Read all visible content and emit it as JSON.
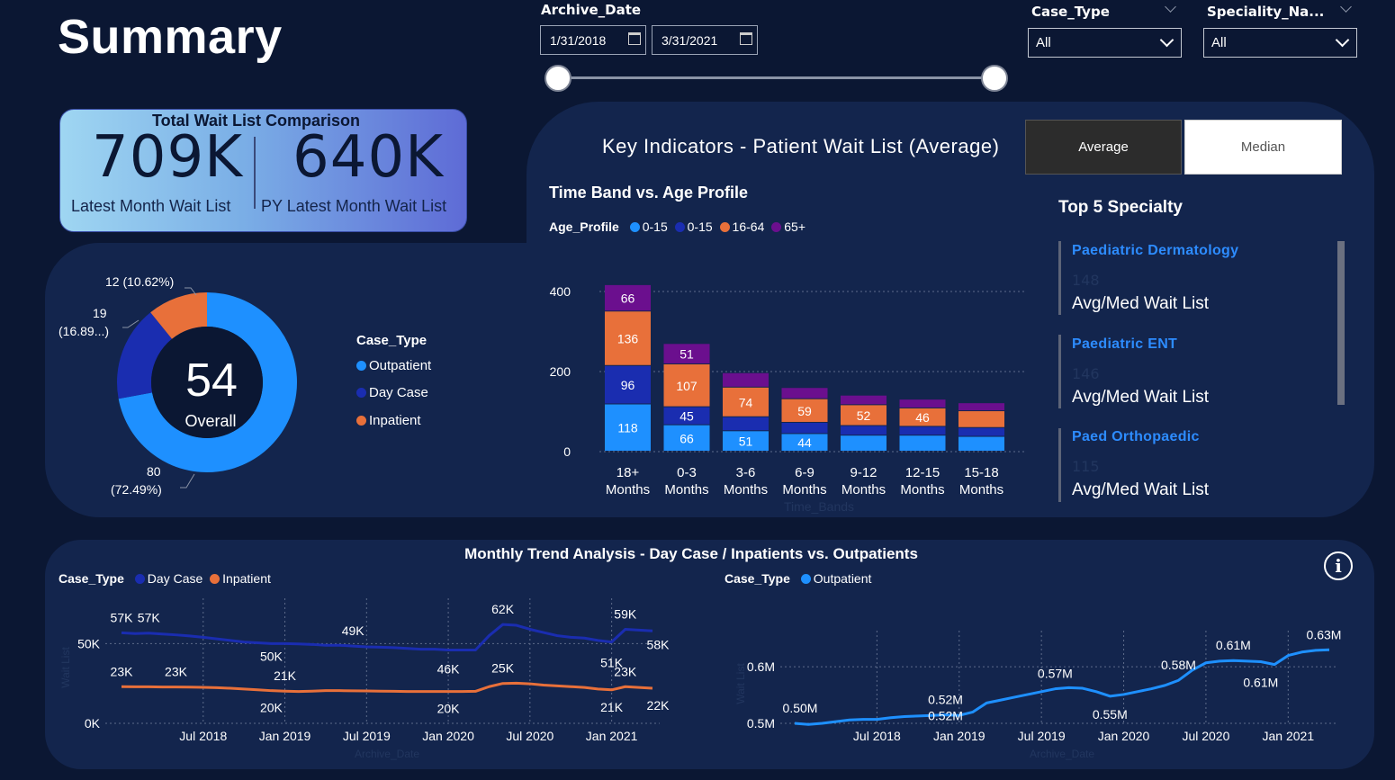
{
  "page_title": "Summary",
  "filters": {
    "archive_date_label": "Archive_Date",
    "date_start": "1/31/2018",
    "date_end": "3/31/2021",
    "case_type_label": "Case_Type",
    "case_type_value": "All",
    "speciality_label": "Speciality_Na...",
    "speciality_value": "All"
  },
  "kpi": {
    "title": "Total Wait List Comparison",
    "latest_value": "709K",
    "latest_label": "Latest Month Wait List",
    "py_value": "640K",
    "py_label": "PY Latest Month Wait List"
  },
  "donut": {
    "center_value": "54",
    "center_label": "Overall",
    "legend_title": "Case_Type",
    "slices": [
      {
        "name": "Outpatient",
        "value": 80,
        "label_value": "80",
        "label_pct": "(72.49%)",
        "color": "#1e90ff"
      },
      {
        "name": "Day Case",
        "value": 19,
        "label_value": "19",
        "label_pct": "(16.89...)",
        "color": "#1a2db0"
      },
      {
        "name": "Inpatient",
        "value": 12,
        "label_value": "12 (10.62%)",
        "label_pct": "",
        "color": "#e8703a"
      }
    ]
  },
  "key_indicators": {
    "title": "Key Indicators - Patient Wait List (Average)",
    "toggle_average": "Average",
    "toggle_median": "Median"
  },
  "bar_chart_title": "Time Band vs. Age Profile",
  "bar_legend": {
    "title": "Age_Profile",
    "items": [
      {
        "label": "0-15",
        "color": "#1e90ff"
      },
      {
        "label": "0-15",
        "color": "#1a2db0"
      },
      {
        "label": "16-64",
        "color": "#e8703a"
      },
      {
        "label": "65+",
        "color": "#6b0f8e"
      }
    ]
  },
  "bar_x_axis_title": "Time_Bands",
  "top5": {
    "title": "Top 5 Specialty",
    "items": [
      {
        "name": "Paediatric Dermatology",
        "value": "148",
        "label": "Avg/Med Wait List"
      },
      {
        "name": "Paediatric ENT",
        "value": "146",
        "label": "Avg/Med Wait List"
      },
      {
        "name": "Paed Orthopaedic",
        "value": "115",
        "label": "Avg/Med Wait List"
      }
    ]
  },
  "trend": {
    "title": "Monthly Trend Analysis - Day Case / Inpatients vs. Outpatients",
    "left_legend_title": "Case_Type",
    "left_legend": [
      {
        "label": "Day Case",
        "color": "#1a2db0"
      },
      {
        "label": "Inpatient",
        "color": "#e8703a"
      }
    ],
    "right_legend_title": "Case_Type",
    "right_legend": [
      {
        "label": "Outpatient",
        "color": "#1e90ff"
      }
    ],
    "left_y_title": "Wait List",
    "right_y_title": "Wait List",
    "left_x_title": "Archive_Date",
    "right_x_title": "Archive_Date",
    "info_icon": "info-icon"
  },
  "chart_data": [
    {
      "type": "pie",
      "categories": [
        "Outpatient",
        "Day Case",
        "Inpatient"
      ],
      "values": [
        80,
        19,
        12
      ]
    },
    {
      "type": "bar",
      "title": "Time Band vs. Age Profile",
      "categories": [
        "18+ Months",
        "0-3 Months",
        "3-6 Months",
        "6-9 Months",
        "9-12 Months",
        "12-15 Months",
        "15-18 Months"
      ],
      "ylim": [
        0,
        400
      ],
      "yticks": [
        0,
        200,
        400
      ],
      "series": [
        {
          "name": "0-15",
          "color": "#1e90ff",
          "values": [
            118,
            66,
            51,
            44,
            40,
            40,
            37
          ],
          "labels": [
            "118",
            "66",
            "51",
            "44",
            "",
            "",
            ""
          ]
        },
        {
          "name": "0-15",
          "color": "#1a2db0",
          "values": [
            96,
            45,
            35,
            28,
            24,
            22,
            22
          ],
          "labels": [
            "96",
            "45",
            "",
            "",
            "",
            "",
            ""
          ]
        },
        {
          "name": "16-64",
          "color": "#e8703a",
          "values": [
            136,
            107,
            74,
            59,
            52,
            46,
            42
          ],
          "labels": [
            "136",
            "107",
            "74",
            "59",
            "52",
            "46",
            ""
          ]
        },
        {
          "name": "65+",
          "color": "#6b0f8e",
          "values": [
            66,
            51,
            36,
            28,
            24,
            22,
            20
          ],
          "labels": [
            "66",
            "51",
            "",
            "",
            "",
            "",
            ""
          ]
        }
      ]
    },
    {
      "type": "line",
      "x_ticks": [
        "Jul 2018",
        "Jan 2019",
        "Jul 2019",
        "Jan 2020",
        "Jul 2020",
        "Jan 2021"
      ],
      "y_ticks": [
        "0K",
        "50K"
      ],
      "ylim": [
        0,
        70000
      ],
      "series": [
        {
          "name": "Day Case",
          "color": "#1a2db0",
          "values": [
            56800,
            56300,
            56600,
            56000,
            55500,
            54800,
            54000,
            53000,
            52000,
            51000,
            50500,
            50000,
            50000,
            49800,
            49500,
            49000,
            49000,
            48500,
            48000,
            47800,
            47500,
            47000,
            46500,
            46500,
            46000,
            46000,
            46000,
            55000,
            62000,
            61500,
            59000,
            57000,
            55000,
            54000,
            53500,
            52000,
            51000,
            59000,
            58500,
            58000
          ]
        },
        {
          "name": "Inpatient",
          "color": "#e8703a",
          "values": [
            23000,
            22900,
            22900,
            22800,
            22800,
            22700,
            22600,
            22400,
            22000,
            21500,
            21000,
            20500,
            20200,
            20000,
            20200,
            20500,
            20500,
            20400,
            20300,
            20200,
            20100,
            20000,
            20000,
            20000,
            20000,
            20000,
            20100,
            23000,
            25000,
            25200,
            24800,
            24000,
            23500,
            23000,
            22500,
            21500,
            21000,
            23000,
            22500,
            22000
          ]
        }
      ],
      "data_labels": [
        "57K",
        "57K",
        "50K",
        "49K",
        "46K",
        "62K",
        "59K",
        "51K",
        "58K",
        "23K",
        "23K",
        "21K",
        "20K",
        "20K",
        "25K",
        "21K",
        "23K",
        "22K"
      ]
    },
    {
      "type": "line",
      "x_ticks": [
        "Jul 2018",
        "Jan 2019",
        "Jul 2019",
        "Jan 2020",
        "Jul 2020",
        "Jan 2021"
      ],
      "y_ticks": [
        "0.5M",
        "0.6M"
      ],
      "ylim": [
        0.5,
        0.64
      ],
      "series": [
        {
          "name": "Outpatient",
          "color": "#1e90ff",
          "values": [
            0.5,
            0.498,
            0.5,
            0.503,
            0.506,
            0.507,
            0.507,
            0.51,
            0.512,
            0.513,
            0.514,
            0.515,
            0.514,
            0.52,
            0.536,
            0.541,
            0.546,
            0.551,
            0.556,
            0.561,
            0.563,
            0.562,
            0.556,
            0.548,
            0.551,
            0.556,
            0.561,
            0.567,
            0.576,
            0.594,
            0.607,
            0.61,
            0.611,
            0.61,
            0.609,
            0.604,
            0.62,
            0.626,
            0.629,
            0.63
          ]
        }
      ],
      "data_labels": [
        "0.50M",
        "0.52M",
        "0.52M",
        "0.57M",
        "0.55M",
        "0.58M",
        "0.61M",
        "0.61M",
        "0.63M"
      ]
    }
  ]
}
